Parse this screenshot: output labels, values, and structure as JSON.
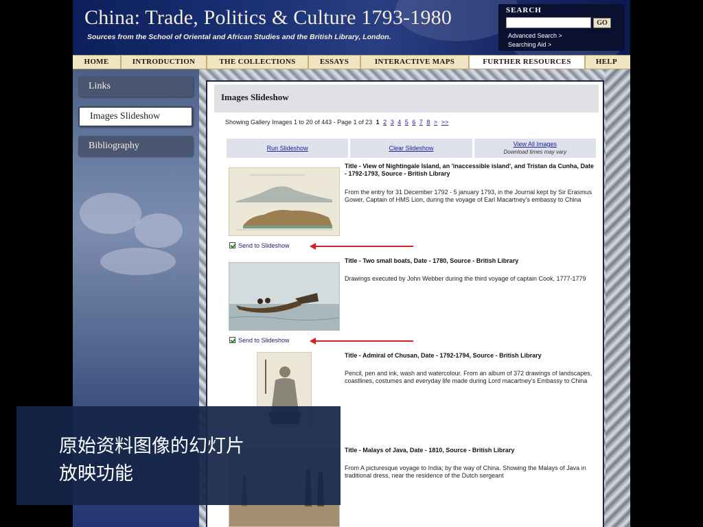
{
  "header": {
    "title": "China: Trade, Politics & Culture 1793-1980",
    "subtitle": "Sources from the School of Oriental and African Studies and the British Library, London.",
    "search": {
      "label": "SEARCH",
      "value": "",
      "go_label": "GO",
      "advanced_label": "Advanced Search >",
      "aid_label": "Searching Aid >"
    }
  },
  "nav": {
    "items": [
      "HOME",
      "INTRODUCTION",
      "THE COLLECTIONS",
      "ESSAYS",
      "INTERACTIVE MAPS",
      "FURTHER RESOURCES",
      "HELP"
    ],
    "active": "FURTHER RESOURCES"
  },
  "sidebar": {
    "items": [
      "Links",
      "Images Slideshow",
      "Bibliography"
    ],
    "active": "Images Slideshow"
  },
  "content": {
    "title": "Images Slideshow",
    "pager": {
      "prefix": "Showing Gallery Images 1 to 20 of 443 - Page 1 of 23",
      "current": "1",
      "pages": [
        "2",
        "3",
        "4",
        "5",
        "6",
        "7",
        "8",
        ">",
        ">>"
      ]
    },
    "actions": {
      "run": "Run Slideshow",
      "clear": "Clear Slideshow",
      "view_all": "View All Images",
      "view_note": "Download times may vary"
    },
    "send_label": "Send to Slideshow",
    "entries": [
      {
        "title": "Title - View of Nightingale Island, an 'inaccessible island', and Tristan da Cunha, Date - 1792-1793, Source - British Library",
        "description": "From the entry for 31 December 1792 - 5 january 1793, in the Journal kept by Sir Erasmus Gower, Captain of HMS Lion, during the voyage of Earl Macartney's embassy to China"
      },
      {
        "title": "Title - Two small boats, Date - 1780, Source - British Library",
        "description": "Drawings executed by John Webber during the third voyage of captain Cook, 1777-1779"
      },
      {
        "title": "Title - Admiral of Chusan, Date - 1792-1794, Source - British Library",
        "description": "Pencil, pen and ink, wash and watercolour. From an album of 372 drawings of landscapes, coastlines, costumes and everyday life made during Lord macartney's Embassy to China"
      },
      {
        "title": "Title - Malays of Java, Date - 1810, Source - British Library",
        "description": "From A picturesque voyage to India; by the way of China. Showing the Malays of Java in traditional dress, near the residence of the Dutch sergeant"
      }
    ]
  },
  "caption": {
    "line1": "原始资料图像的幻灯片",
    "line2": "放映功能"
  }
}
